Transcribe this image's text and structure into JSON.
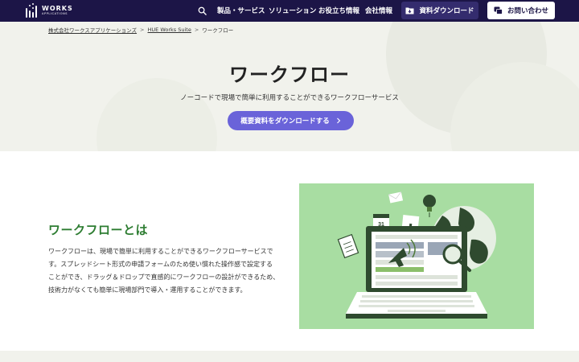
{
  "header": {
    "logo_main": "WORKS",
    "logo_sub": "APPLICATIONS",
    "search_icon": "search-icon",
    "nav": [
      "製品・サービス",
      "ソリューション",
      "お役立ち情報",
      "会社情報"
    ],
    "download_label": "資料ダウンロード",
    "contact_label": "お問い合わせ"
  },
  "breadcrumb": [
    "株式会社ワークスアプリケーションズ",
    "HUE Works Suite",
    "ワークフロー"
  ],
  "hero": {
    "title": "ワークフロー",
    "subtitle": "ノーコードで現場で簡単に利用することができるワークフローサービス",
    "cta_label": "概要資料をダウンロードする"
  },
  "about": {
    "title": "ワークフローとは",
    "lines": [
      "ワークフローは、現場で簡単に利用することができるワークフローサービスで",
      "す。スプレッドシート形式の申請フォームのため使い慣れた操作感で設定する",
      "ことができ、ドラッグ＆ドロップで直感的にワークフローの設計ができるため、",
      "技術力がなくても簡単に現場部門で導入・運用することができます。"
    ]
  },
  "illustration": {
    "calendar_number": "31"
  },
  "colors": {
    "header_bg": "#1c1547",
    "hero_bg": "#f1f2ec",
    "cta": "#6a63d9",
    "accent_green": "#2e7d32",
    "illust_bg": "#a8dda2"
  }
}
